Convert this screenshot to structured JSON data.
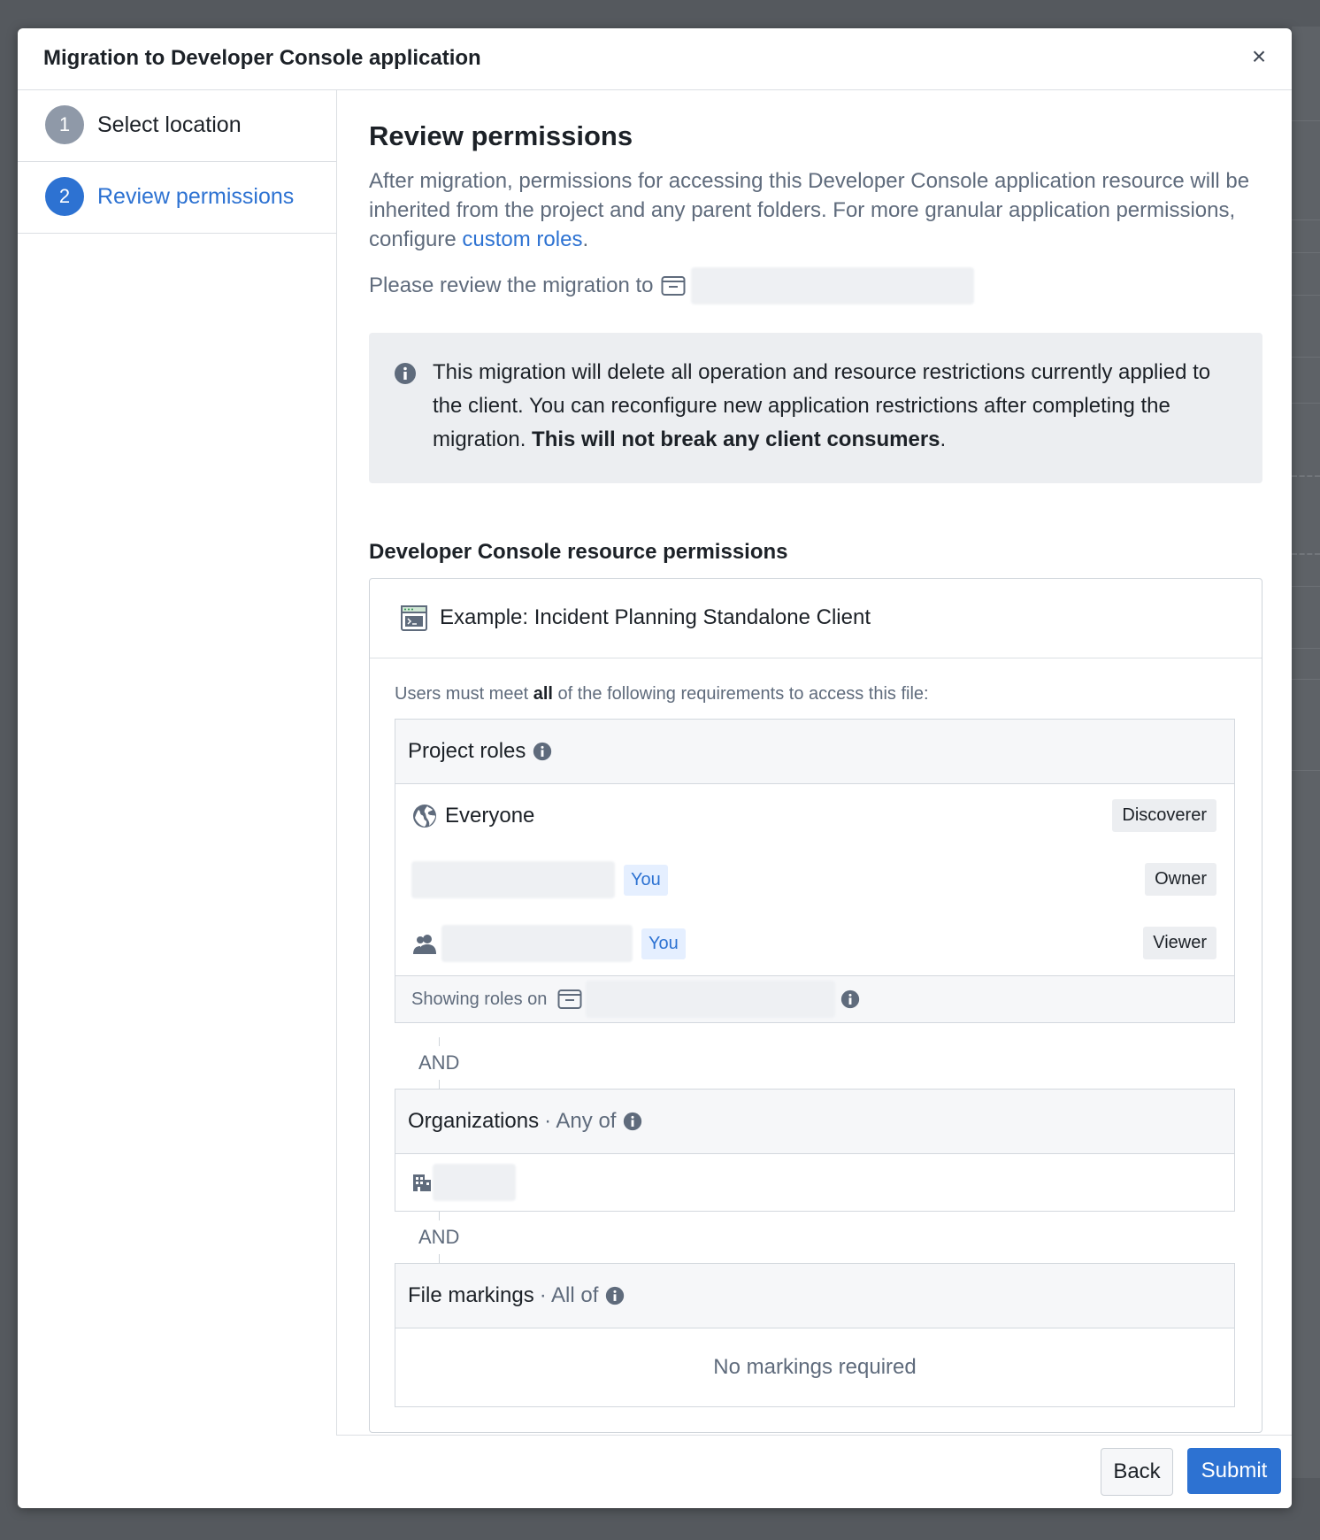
{
  "modal": {
    "title": "Migration to Developer Console application",
    "close_label": "×"
  },
  "steps": [
    {
      "number": "1",
      "label": "Select location"
    },
    {
      "number": "2",
      "label": "Review permissions"
    }
  ],
  "content": {
    "heading": "Review permissions",
    "description": "After migration, permissions for accessing this Developer Console application resource will be inherited from the project and any parent folders. For more granular application permissions, configure ",
    "custom_roles_link": "custom roles",
    "description_end": ".",
    "review_prefix": "Please review the migration to",
    "callout_text": "This migration will delete all operation and resource restrictions currently applied to the client. You can reconfigure new application restrictions after completing the migration. ",
    "callout_bold": "This will not break any client consumers",
    "callout_end": ".",
    "section_heading": "Developer Console resource permissions"
  },
  "permissions": {
    "app_name": "Example: Incident Planning Standalone Client",
    "must_prefix": "Users must meet ",
    "must_bold": "all",
    "must_suffix": " of the following requirements to access this file:",
    "project_roles": {
      "title": "Project roles",
      "rows": [
        {
          "name": "Everyone",
          "role": "Discoverer"
        },
        {
          "you": "You",
          "role": "Owner"
        },
        {
          "you": "You",
          "role": "Viewer"
        }
      ],
      "showing_roles_on": "Showing roles on"
    },
    "and_label": "AND",
    "organizations": {
      "title": "Organizations",
      "qualifier": "· Any of"
    },
    "file_markings": {
      "title": "File markings",
      "qualifier": "· All of",
      "empty": "No markings required"
    }
  },
  "footer": {
    "back_label": "Back",
    "submit_label": "Submit"
  },
  "colors": {
    "accent": "#2d72d2",
    "overlay": "#55595e",
    "muted_text": "#5f6b7c"
  },
  "icons": [
    "close-icon",
    "info-icon",
    "folder-icon",
    "application-icon",
    "globe-icon",
    "people-icon",
    "building-icon"
  ]
}
